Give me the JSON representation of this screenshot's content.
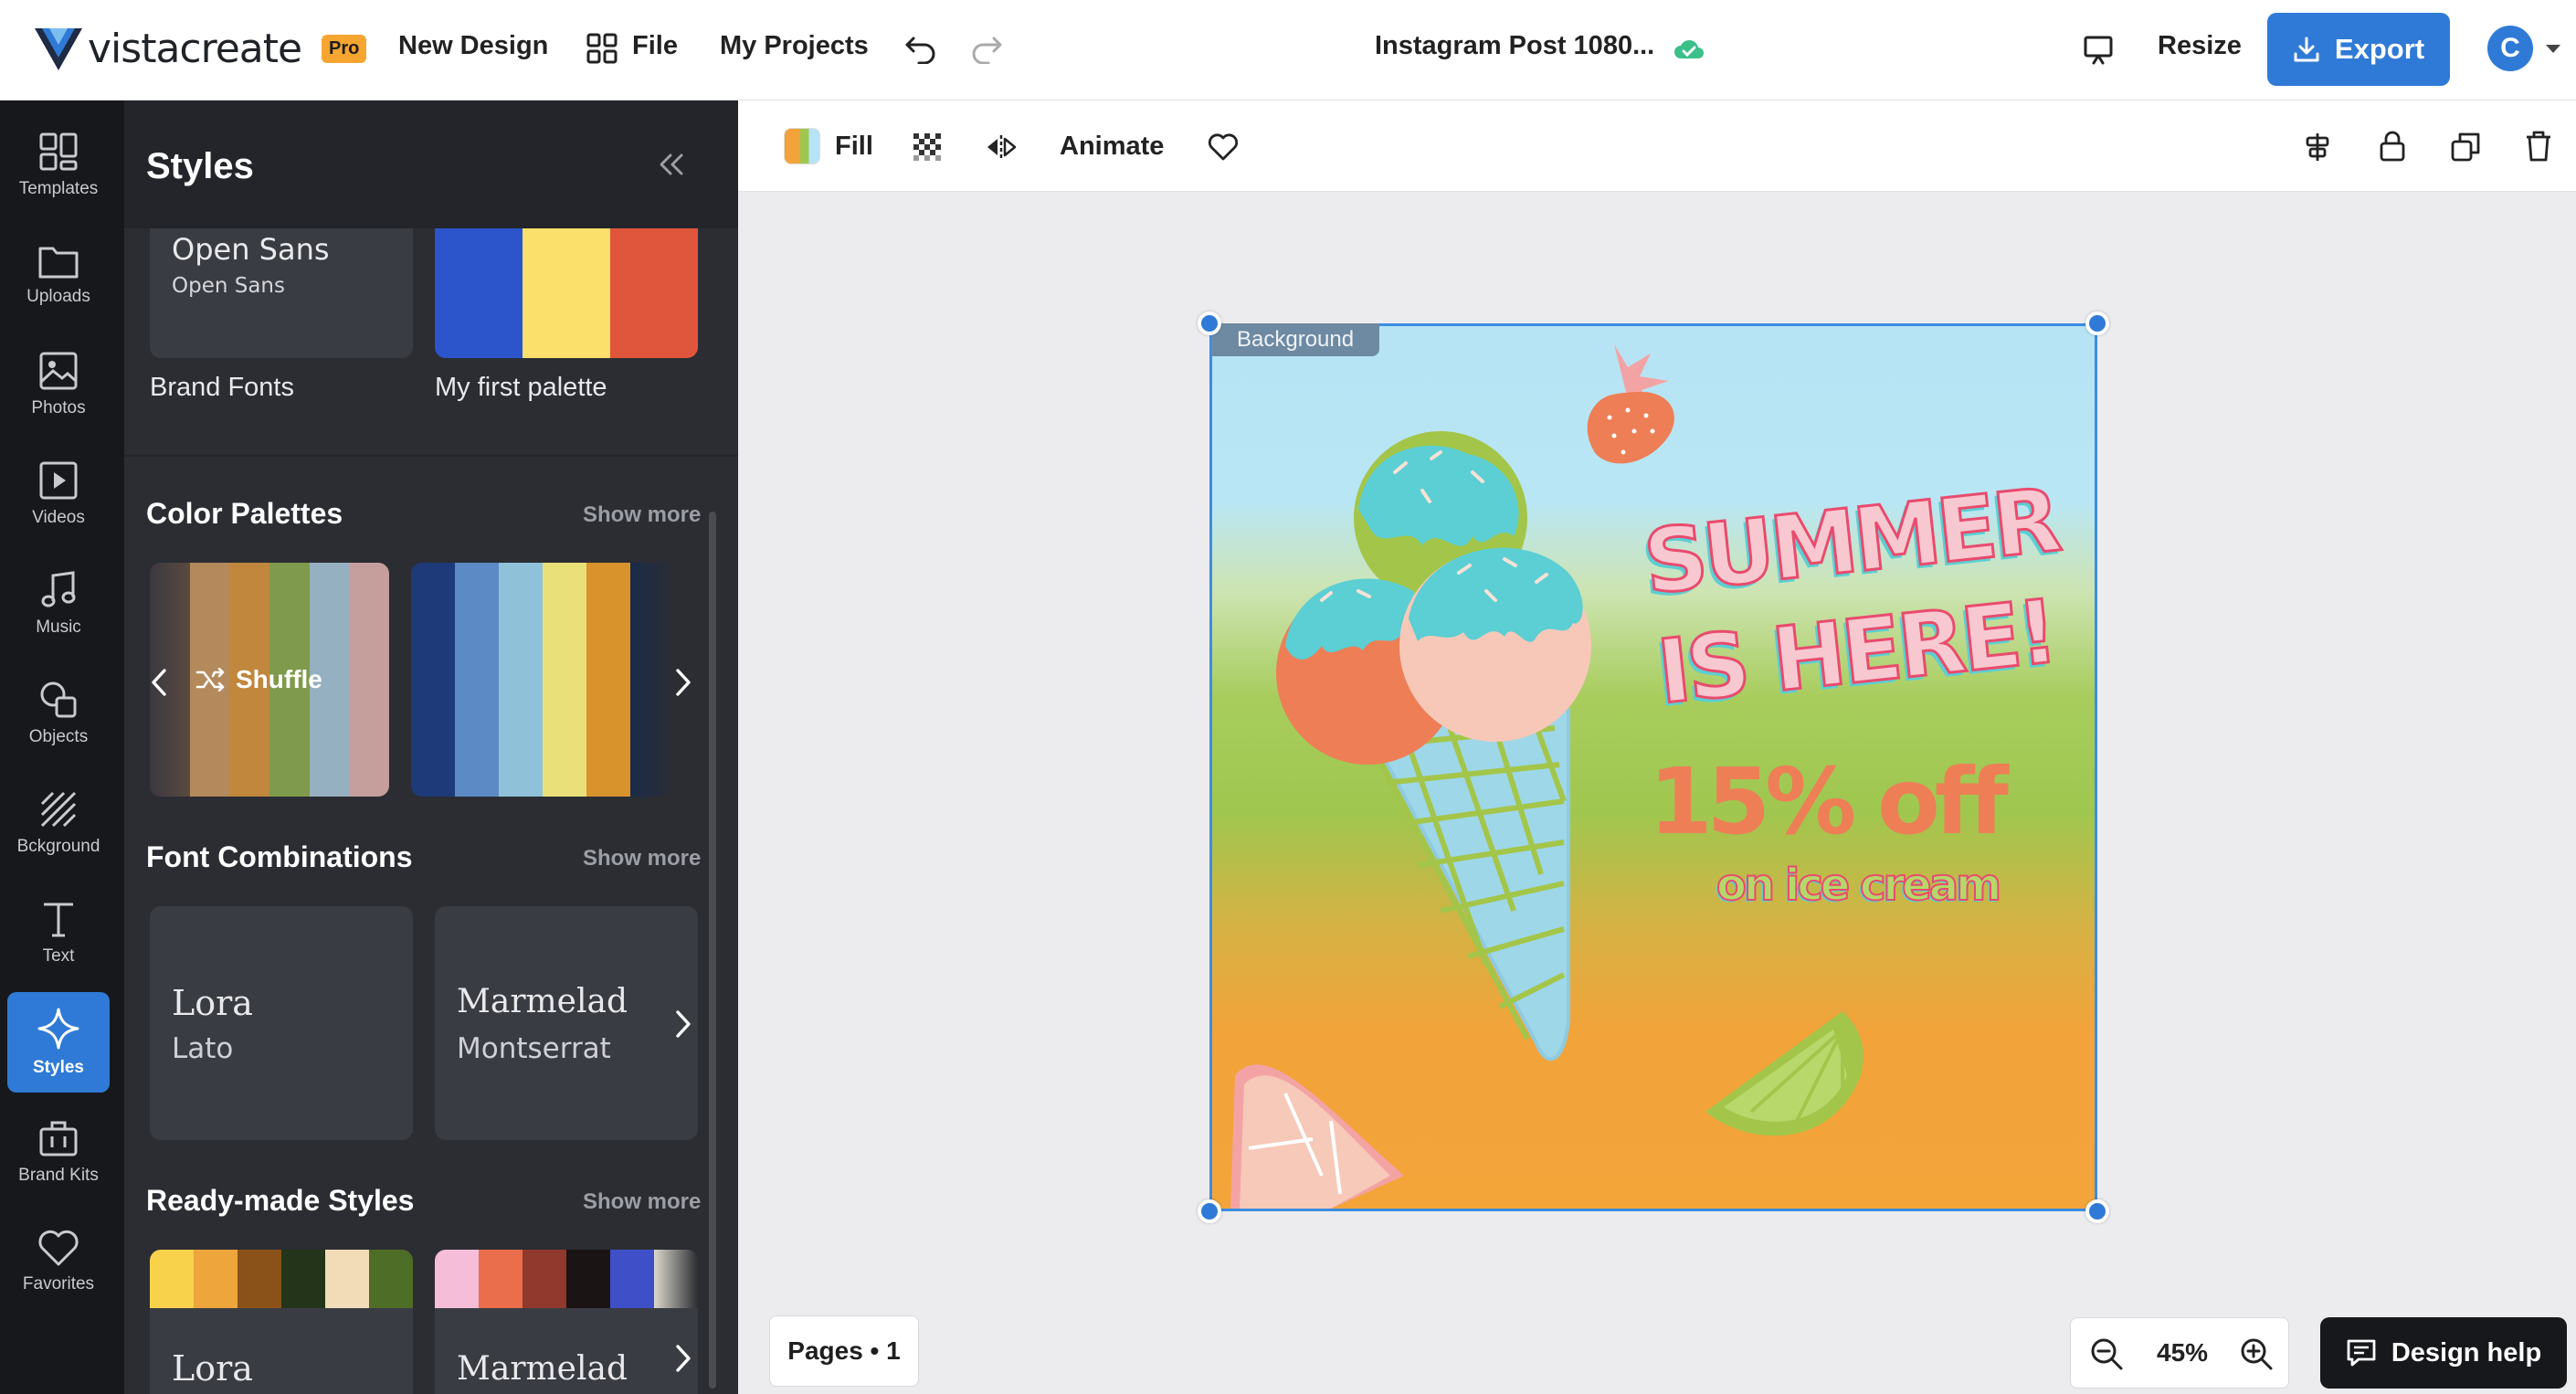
{
  "header": {
    "logo_text": "vistacreate",
    "pro_badge": "Pro",
    "new_design": "New Design",
    "file": "File",
    "my_projects": "My Projects",
    "doc_title": "Instagram Post 1080...",
    "resize": "Resize",
    "export": "Export",
    "avatar_initial": "C"
  },
  "rail": {
    "items": [
      {
        "label": "Templates",
        "icon": "templates-icon"
      },
      {
        "label": "Uploads",
        "icon": "folder-icon"
      },
      {
        "label": "Photos",
        "icon": "image-icon"
      },
      {
        "label": "Videos",
        "icon": "video-icon"
      },
      {
        "label": "Music",
        "icon": "music-icon"
      },
      {
        "label": "Objects",
        "icon": "objects-icon"
      },
      {
        "label": "Bckground",
        "icon": "background-icon"
      },
      {
        "label": "Text",
        "icon": "text-icon"
      },
      {
        "label": "Styles",
        "icon": "sparkle-icon"
      },
      {
        "label": "Brand Kits",
        "icon": "briefcase-icon"
      },
      {
        "label": "Favorites",
        "icon": "heart-icon"
      }
    ],
    "active": "Styles"
  },
  "panel": {
    "title": "Styles",
    "brand_fonts": {
      "primary": "Open Sans",
      "secondary": "Open Sans",
      "caption": "Brand Fonts"
    },
    "my_palette": {
      "caption": "My first palette",
      "colors": [
        "#2c55cc",
        "#fbe06b",
        "#e0563c"
      ]
    },
    "color_palettes": {
      "title": "Color Palettes",
      "show_more": "Show more",
      "shuffle": "Shuffle",
      "palette1": [
        "#5a4a40",
        "#b48a5c",
        "#c0873d",
        "#7f9a4c",
        "#95b0c0",
        "#c49f9c"
      ],
      "palette2": [
        "#1e3a78",
        "#5b8ac4",
        "#8fc1d9",
        "#e9e07a",
        "#d9932c",
        "#1a2b4a"
      ]
    },
    "font_combinations": {
      "title": "Font Combinations",
      "show_more": "Show more",
      "combos": [
        {
          "primary": "Lora",
          "secondary": "Lato"
        },
        {
          "primary": "Marmelad",
          "secondary": "Montserrat"
        }
      ]
    },
    "readymade": {
      "title": "Ready-made Styles",
      "show_more": "Show more",
      "styles": [
        {
          "font": "Lora",
          "colors": [
            "#f8d24a",
            "#eda53c",
            "#8a5219",
            "#23341a",
            "#f2dcb8",
            "#4e6d27"
          ]
        },
        {
          "font": "Marmelad",
          "colors": [
            "#f5bdd8",
            "#ea6e4c",
            "#90392c",
            "#1a1414",
            "#3f4fc8",
            "#dcd8cc"
          ]
        }
      ]
    }
  },
  "toolbar": {
    "fill": "Fill",
    "animate": "Animate"
  },
  "canvas": {
    "background_tag": "Background",
    "headline": "SUMMER IS HERE!",
    "discount": "15% off",
    "subtitle": "on ice cream"
  },
  "footer": {
    "pages": "Pages • 1",
    "zoom": "45%",
    "design_help": "Design help"
  },
  "colors": {
    "accent": "#2f7ad6",
    "panel_bg": "#2b2d33",
    "rail_bg": "#17181b"
  }
}
